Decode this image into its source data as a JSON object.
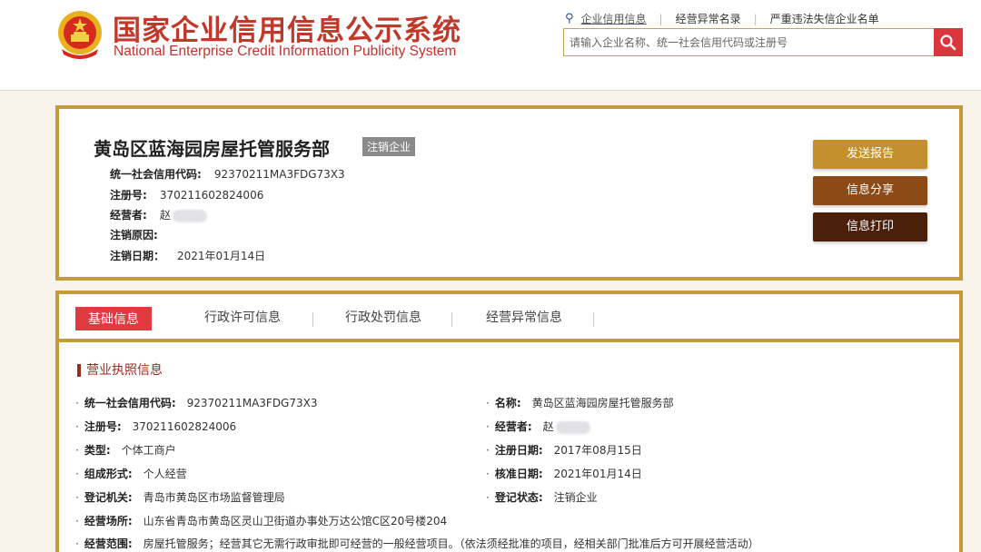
{
  "header": {
    "title_cn": "国家企业信用信息公示系统",
    "title_en": "National Enterprise Credit Information Publicity System",
    "links": [
      "企业信用信息",
      "经营异常名录",
      "严重违法失信企业名单"
    ],
    "search_placeholder": "请输入企业名称、统一社会信用代码或注册号"
  },
  "company": {
    "name": "黄岛区蓝海园房屋托管服务部",
    "status_badge": "注销企业",
    "fields": [
      {
        "label": "统一社会信用代码:",
        "value": "92370211MA3FDG73X3"
      },
      {
        "label": "注册号:",
        "value": "370211602824006"
      },
      {
        "label": "经营者:",
        "value": "赵"
      },
      {
        "label": "注销原因:",
        "value": ""
      },
      {
        "label": "注销日期：",
        "value": "2021年01月14日"
      }
    ],
    "buttons": {
      "report": "发送报告",
      "share": "信息分享",
      "print": "信息打印"
    }
  },
  "tabs": [
    "基础信息",
    "行政许可信息",
    "行政处罚信息",
    "经营异常信息"
  ],
  "license": {
    "section_title": "营业执照信息",
    "left": [
      {
        "label": "统一社会信用代码:",
        "value": "92370211MA3FDG73X3"
      },
      {
        "label": "注册号:",
        "value": "370211602824006"
      },
      {
        "label": "类型:",
        "value": "个体工商户"
      },
      {
        "label": "组成形式:",
        "value": "个人经营"
      },
      {
        "label": "登记机关:",
        "value": "青岛市黄岛区市场监督管理局"
      },
      {
        "label": "经营场所:",
        "value": "山东省青岛市黄岛区灵山卫街道办事处万达公馆C区20号楼204"
      },
      {
        "label": "经营范围:",
        "value": "房屋托管服务；经营其它无需行政审批即可经营的一般经营项目。（依法须经批准的项目，经相关部门批准后方可开展经营活动）"
      }
    ],
    "right": [
      {
        "label": "名称:",
        "value": "黄岛区蓝海园房屋托管服务部"
      },
      {
        "label": "经营者:",
        "value": "赵"
      },
      {
        "label": "注册日期:",
        "value": "2017年08月15日"
      },
      {
        "label": "核准日期:",
        "value": "2021年01月14日"
      },
      {
        "label": "登记状态:",
        "value": "注销企业"
      }
    ]
  },
  "colors": {
    "gold_border": "#c49a3a",
    "red_accent": "#e0393f",
    "title_red": "#c0392b"
  }
}
